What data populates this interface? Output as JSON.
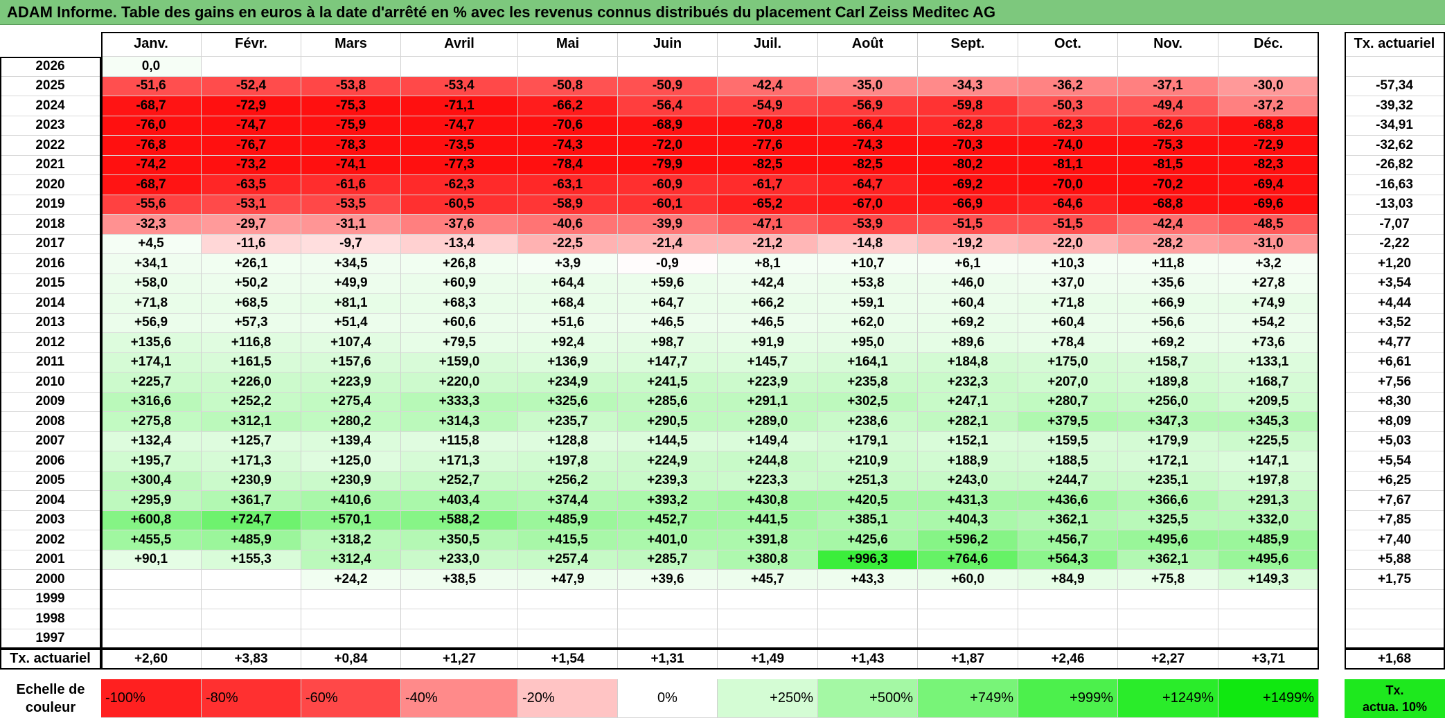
{
  "title": "ADAM Informe. Table des gains en euros à la date d'arrêté en % avec les revenus connus distribués du placement Carl Zeiss Meditec AG",
  "chart_data": {
    "type": "heatmap",
    "title": "ADAM Informe. Table des gains en euros à la date d'arrêté en % avec les revenus connus distribués du placement Carl Zeiss Meditec AG",
    "months": [
      "Janv.",
      "Févr.",
      "Mars",
      "Avril",
      "Mai",
      "Juin",
      "Juil.",
      "Août",
      "Sept.",
      "Oct.",
      "Nov.",
      "Déc."
    ],
    "annual_header": "Tx. actuariel",
    "rows": [
      {
        "year": "2026",
        "values": [
          "0,0",
          "",
          "",
          "",
          "",
          "",
          "",
          "",
          "",
          "",
          "",
          ""
        ],
        "annual": ""
      },
      {
        "year": "2025",
        "values": [
          "-51,6",
          "-52,4",
          "-53,8",
          "-53,4",
          "-50,8",
          "-50,9",
          "-42,4",
          "-35,0",
          "-34,3",
          "-36,2",
          "-37,1",
          "-30,0"
        ],
        "annual": "-57,34"
      },
      {
        "year": "2024",
        "values": [
          "-68,7",
          "-72,9",
          "-75,3",
          "-71,1",
          "-66,2",
          "-56,4",
          "-54,9",
          "-56,9",
          "-59,8",
          "-50,3",
          "-49,4",
          "-37,2"
        ],
        "annual": "-39,32"
      },
      {
        "year": "2023",
        "values": [
          "-76,0",
          "-74,7",
          "-75,9",
          "-74,7",
          "-70,6",
          "-68,9",
          "-70,8",
          "-66,4",
          "-62,8",
          "-62,3",
          "-62,6",
          "-68,8"
        ],
        "annual": "-34,91"
      },
      {
        "year": "2022",
        "values": [
          "-76,8",
          "-76,7",
          "-78,3",
          "-73,5",
          "-74,3",
          "-72,0",
          "-77,6",
          "-74,3",
          "-70,3",
          "-74,0",
          "-75,3",
          "-72,9"
        ],
        "annual": "-32,62"
      },
      {
        "year": "2021",
        "values": [
          "-74,2",
          "-73,2",
          "-74,1",
          "-77,3",
          "-78,4",
          "-79,9",
          "-82,5",
          "-82,5",
          "-80,2",
          "-81,1",
          "-81,5",
          "-82,3"
        ],
        "annual": "-26,82"
      },
      {
        "year": "2020",
        "values": [
          "-68,7",
          "-63,5",
          "-61,6",
          "-62,3",
          "-63,1",
          "-60,9",
          "-61,7",
          "-64,7",
          "-69,2",
          "-70,0",
          "-70,2",
          "-69,4"
        ],
        "annual": "-16,63"
      },
      {
        "year": "2019",
        "values": [
          "-55,6",
          "-53,1",
          "-53,5",
          "-60,5",
          "-58,9",
          "-60,1",
          "-65,2",
          "-67,0",
          "-66,9",
          "-64,6",
          "-68,8",
          "-69,6"
        ],
        "annual": "-13,03"
      },
      {
        "year": "2018",
        "values": [
          "-32,3",
          "-29,7",
          "-31,1",
          "-37,6",
          "-40,6",
          "-39,9",
          "-47,1",
          "-53,9",
          "-51,5",
          "-51,5",
          "-42,4",
          "-48,5"
        ],
        "annual": "-7,07"
      },
      {
        "year": "2017",
        "values": [
          "+4,5",
          "-11,6",
          "-9,7",
          "-13,4",
          "-22,5",
          "-21,4",
          "-21,2",
          "-14,8",
          "-19,2",
          "-22,0",
          "-28,2",
          "-31,0"
        ],
        "annual": "-2,22"
      },
      {
        "year": "2016",
        "values": [
          "+34,1",
          "+26,1",
          "+34,5",
          "+26,8",
          "+3,9",
          "-0,9",
          "+8,1",
          "+10,7",
          "+6,1",
          "+10,3",
          "+11,8",
          "+3,2"
        ],
        "annual": "+1,20"
      },
      {
        "year": "2015",
        "values": [
          "+58,0",
          "+50,2",
          "+49,9",
          "+60,9",
          "+64,4",
          "+59,6",
          "+42,4",
          "+53,8",
          "+46,0",
          "+37,0",
          "+35,6",
          "+27,8"
        ],
        "annual": "+3,54"
      },
      {
        "year": "2014",
        "values": [
          "+71,8",
          "+68,5",
          "+81,1",
          "+68,3",
          "+68,4",
          "+64,7",
          "+66,2",
          "+59,1",
          "+60,4",
          "+71,8",
          "+66,9",
          "+74,9"
        ],
        "annual": "+4,44"
      },
      {
        "year": "2013",
        "values": [
          "+56,9",
          "+57,3",
          "+51,4",
          "+60,6",
          "+51,6",
          "+46,5",
          "+46,5",
          "+62,0",
          "+69,2",
          "+60,4",
          "+56,6",
          "+54,2"
        ],
        "annual": "+3,52"
      },
      {
        "year": "2012",
        "values": [
          "+135,6",
          "+116,8",
          "+107,4",
          "+79,5",
          "+92,4",
          "+98,7",
          "+91,9",
          "+95,0",
          "+89,6",
          "+78,4",
          "+69,2",
          "+73,6"
        ],
        "annual": "+4,77"
      },
      {
        "year": "2011",
        "values": [
          "+174,1",
          "+161,5",
          "+157,6",
          "+159,0",
          "+136,9",
          "+147,7",
          "+145,7",
          "+164,1",
          "+184,8",
          "+175,0",
          "+158,7",
          "+133,1"
        ],
        "annual": "+6,61"
      },
      {
        "year": "2010",
        "values": [
          "+225,7",
          "+226,0",
          "+223,9",
          "+220,0",
          "+234,9",
          "+241,5",
          "+223,9",
          "+235,8",
          "+232,3",
          "+207,0",
          "+189,8",
          "+168,7"
        ],
        "annual": "+7,56"
      },
      {
        "year": "2009",
        "values": [
          "+316,6",
          "+252,2",
          "+275,4",
          "+333,3",
          "+325,6",
          "+285,6",
          "+291,1",
          "+302,5",
          "+247,1",
          "+280,7",
          "+256,0",
          "+209,5"
        ],
        "annual": "+8,30"
      },
      {
        "year": "2008",
        "values": [
          "+275,8",
          "+312,1",
          "+280,2",
          "+314,3",
          "+235,7",
          "+290,5",
          "+289,0",
          "+238,6",
          "+282,1",
          "+379,5",
          "+347,3",
          "+345,3"
        ],
        "annual": "+8,09"
      },
      {
        "year": "2007",
        "values": [
          "+132,4",
          "+125,7",
          "+139,4",
          "+115,8",
          "+128,8",
          "+144,5",
          "+149,4",
          "+179,1",
          "+152,1",
          "+159,5",
          "+179,9",
          "+225,5"
        ],
        "annual": "+5,03"
      },
      {
        "year": "2006",
        "values": [
          "+195,7",
          "+171,3",
          "+125,0",
          "+171,3",
          "+197,8",
          "+224,9",
          "+244,8",
          "+210,9",
          "+188,9",
          "+188,5",
          "+172,1",
          "+147,1"
        ],
        "annual": "+5,54"
      },
      {
        "year": "2005",
        "values": [
          "+300,4",
          "+230,9",
          "+230,9",
          "+252,7",
          "+256,2",
          "+239,3",
          "+223,3",
          "+251,3",
          "+243,0",
          "+244,7",
          "+235,1",
          "+197,8"
        ],
        "annual": "+6,25"
      },
      {
        "year": "2004",
        "values": [
          "+295,9",
          "+361,7",
          "+410,6",
          "+403,4",
          "+374,4",
          "+393,2",
          "+430,8",
          "+420,5",
          "+431,3",
          "+436,6",
          "+366,6",
          "+291,3"
        ],
        "annual": "+7,67"
      },
      {
        "year": "2003",
        "values": [
          "+600,8",
          "+724,7",
          "+570,1",
          "+588,2",
          "+485,9",
          "+452,7",
          "+441,5",
          "+385,1",
          "+404,3",
          "+362,1",
          "+325,5",
          "+332,0"
        ],
        "annual": "+7,85"
      },
      {
        "year": "2002",
        "values": [
          "+455,5",
          "+485,9",
          "+318,2",
          "+350,5",
          "+415,5",
          "+401,0",
          "+391,8",
          "+425,6",
          "+596,2",
          "+456,7",
          "+495,6",
          "+485,9"
        ],
        "annual": "+7,40"
      },
      {
        "year": "2001",
        "values": [
          "+90,1",
          "+155,3",
          "+312,4",
          "+233,0",
          "+257,4",
          "+285,7",
          "+380,8",
          "+996,3",
          "+764,6",
          "+564,3",
          "+362,1",
          "+495,6"
        ],
        "annual": "+5,88"
      },
      {
        "year": "2000",
        "values": [
          "",
          "",
          "+24,2",
          "+38,5",
          "+47,9",
          "+39,6",
          "+45,7",
          "+43,3",
          "+60,0",
          "+84,9",
          "+75,8",
          "+149,3"
        ],
        "annual": "+1,75"
      },
      {
        "year": "1999",
        "values": [
          "",
          "",
          "",
          "",
          "",
          "",
          "",
          "",
          "",
          "",
          "",
          ""
        ],
        "annual": ""
      },
      {
        "year": "1998",
        "values": [
          "",
          "",
          "",
          "",
          "",
          "",
          "",
          "",
          "",
          "",
          "",
          ""
        ],
        "annual": ""
      },
      {
        "year": "1997",
        "values": [
          "",
          "",
          "",
          "",
          "",
          "",
          "",
          "",
          "",
          "",
          "",
          ""
        ],
        "annual": ""
      }
    ],
    "footer": {
      "label": "Tx. actuariel",
      "values": [
        "+2,60",
        "+3,83",
        "+0,84",
        "+1,27",
        "+1,54",
        "+1,31",
        "+1,49",
        "+1,43",
        "+1,87",
        "+2,46",
        "+2,27",
        "+3,71"
      ],
      "annual": "+1,68"
    },
    "color_scale": {
      "label_line1": "Echelle de",
      "label_line2": "couleur",
      "stops": [
        {
          "label": "-100%",
          "color": "#ff2020"
        },
        {
          "label": "-80%",
          "color": "#ff3030"
        },
        {
          "label": "-60%",
          "color": "#ff4848"
        },
        {
          "label": "-40%",
          "color": "#ff8a8a"
        },
        {
          "label": "-20%",
          "color": "#ffc4c4"
        },
        {
          "label": "0%",
          "color": "#ffffff"
        },
        {
          "label": "+250%",
          "color": "#d4fcd4"
        },
        {
          "label": "+500%",
          "color": "#a4f8a4"
        },
        {
          "label": "+749%",
          "color": "#78f478"
        },
        {
          "label": "+999%",
          "color": "#4cf04c"
        },
        {
          "label": "+1249%",
          "color": "#2aec2a"
        },
        {
          "label": "+1499%",
          "color": "#10e810"
        }
      ],
      "annual_legend_line1": "Tx.",
      "annual_legend_line2": "actua. 10%"
    }
  }
}
